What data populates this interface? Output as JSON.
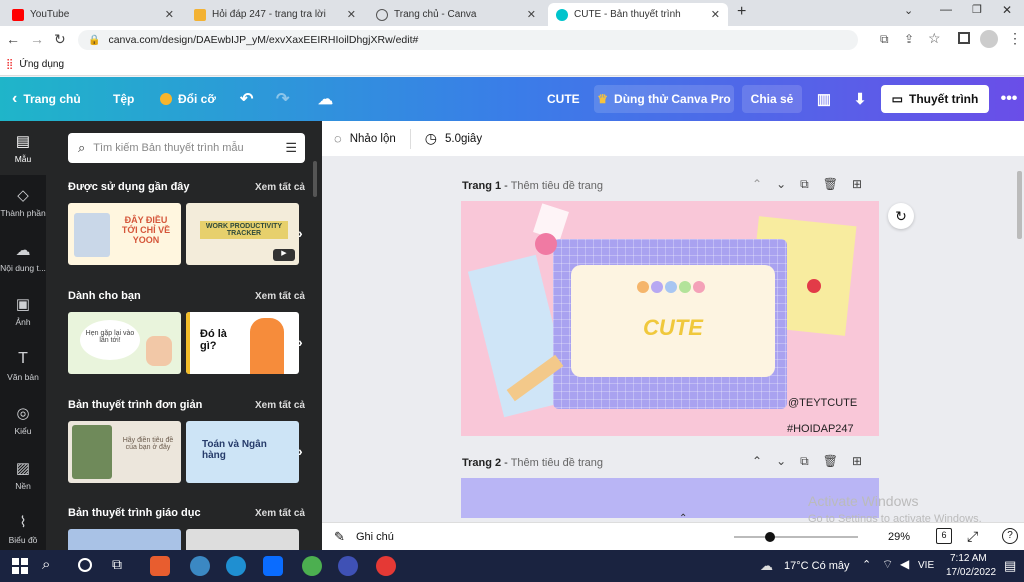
{
  "browser": {
    "tabs": [
      {
        "label": "YouTube"
      },
      {
        "label": "Hỏi đáp 247 - trang tra lời"
      },
      {
        "label": "Trang chủ - Canva"
      },
      {
        "label": "CUTE - Bản thuyết trình"
      }
    ],
    "url": "canva.com/design/DAEwbIJP_yM/exvXaxEEIRHIoilDhgjXRw/edit#",
    "bookmarks_label": "Ứng dụng"
  },
  "topbar": {
    "home": "Trang chủ",
    "file": "Tệp",
    "resize": "Đổi cỡ",
    "title": "CUTE",
    "trial": "Dùng thử Canva Pro",
    "share": "Chia sẻ",
    "present": "Thuyết trình"
  },
  "rail": {
    "items": [
      "Mẫu",
      "Thành phần",
      "Nội dung t...",
      "Ảnh",
      "Văn bản",
      "Kiểu",
      "Nền",
      "Biểu đồ"
    ]
  },
  "panel": {
    "search_placeholder": "Tìm kiếm Bản thuyết trình mẫu",
    "see_all": "Xem tất cả",
    "sections": [
      {
        "title": "Được sử dụng gần đây"
      },
      {
        "title": "Dành cho bạn"
      },
      {
        "title": "Bản thuyết trình đơn giản"
      },
      {
        "title": "Bản thuyết trình giáo dục"
      }
    ],
    "thumbs": {
      "t1": "ĐÂY ĐIỀU TỚI CHỈ VỀ YOON",
      "t2": "WORK PRODUCTIVITY TRACKER",
      "t3": "Hẹn gặp lại vào lần tới!",
      "t4": "Đó là gì?",
      "t5": "Hãy điền tiêu đề của bạn ở đây",
      "t6": "Toán và Ngân hàng"
    }
  },
  "editor": {
    "animate": "Nhảo lộn",
    "duration": "5.0giây",
    "pages": [
      {
        "label": "Trang 1",
        "subtitle": "Thêm tiêu đề trang"
      },
      {
        "label": "Trang 2",
        "subtitle": "Thêm tiêu đề trang"
      }
    ],
    "slide": {
      "title": "CUTE",
      "handle": "@TEYTCUTE",
      "hashtag": "#HOIDAP247"
    },
    "watermark_1": "Activate Windows",
    "watermark_2": "Go to Settings to activate Windows.",
    "notes": "Ghi chú",
    "zoom": "29%",
    "page_count": "6",
    "zoom_fraction": 0.29
  },
  "taskbar": {
    "weather": "17°C Có mây",
    "lang": "VIE",
    "time": "7:12 AM",
    "date": "17/02/2022"
  },
  "colors": {
    "accent_start": "#1fb5c9",
    "accent_end": "#6a4ee8",
    "panel_bg": "#252627",
    "slide_bg": "#f9c7d8"
  }
}
